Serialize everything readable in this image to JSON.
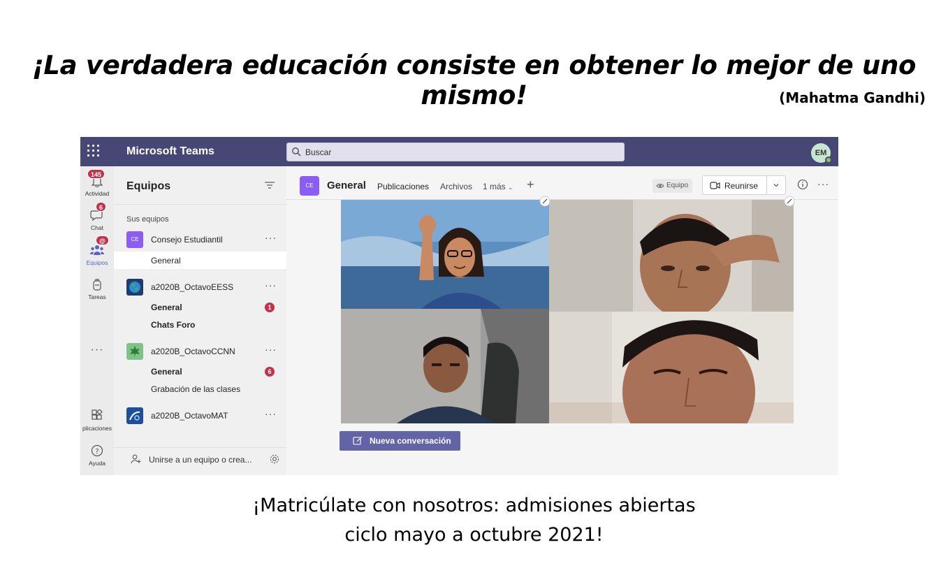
{
  "quote": "¡La verdadera educación consiste en obtener lo mejor de uno mismo!",
  "author": "(Mahatma Gandhi)",
  "promo": {
    "line1": "¡Matricúlate con nosotros: admisiones abiertas",
    "line2": "ciclo mayo a octubre 2021!"
  },
  "teams_app": {
    "title": "Microsoft Teams",
    "search_placeholder": "Buscar",
    "user_initials": "EM",
    "rail": [
      {
        "label": "Actividad",
        "badge": "145",
        "icon": "bell-icon"
      },
      {
        "label": "Chat",
        "badge": "6",
        "icon": "chat-icon"
      },
      {
        "label": "Equipos",
        "badge": "@",
        "icon": "teams-icon"
      },
      {
        "label": "Tareas",
        "icon": "backpack-icon"
      },
      {
        "label": "plicaciones",
        "icon": "apps-icon"
      },
      {
        "label": "Ayuda",
        "icon": "help-icon"
      }
    ],
    "panel": {
      "title": "Equipos",
      "section": "Sus equipos",
      "teams": [
        {
          "tile": "CE",
          "name": "Consejo Estudiantil",
          "channels": [
            {
              "name": "General",
              "bold": false
            }
          ]
        },
        {
          "tile": "",
          "name": "a2020B_OctavoEESS",
          "channels": [
            {
              "name": "General",
              "bold": true,
              "unread": "1"
            },
            {
              "name": "Chats Foro",
              "bold": true
            }
          ]
        },
        {
          "tile": "",
          "name": "a2020B_OctavoCCNN",
          "channels": [
            {
              "name": "General",
              "bold": true,
              "unread": "6"
            },
            {
              "name": "Grabación de las clases",
              "bold": false
            }
          ]
        },
        {
          "tile": "",
          "name": "a2020B_OctavoMAT",
          "channels": []
        }
      ],
      "join_text": "Unirse a un equipo o crea..."
    },
    "channel": {
      "tile": "CE",
      "title": "General",
      "tabs": [
        "Publicaciones",
        "Archivos",
        "1 más"
      ],
      "team_chip": "Equipo",
      "meet_label": "Reunirse",
      "new_conversation": "Nueva conversación"
    },
    "colors": {
      "topbar": "#464775",
      "accent": "#6264a7",
      "badge": "#c4314b"
    }
  }
}
